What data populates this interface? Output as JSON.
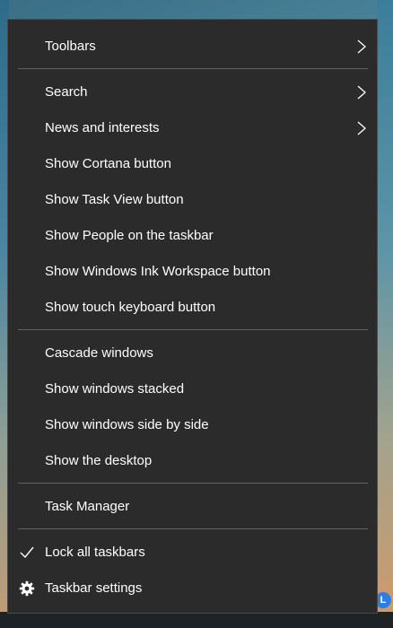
{
  "menu": {
    "toolbars": "Toolbars",
    "search": "Search",
    "news": "News and interests",
    "cortana": "Show Cortana button",
    "taskview": "Show Task View button",
    "people": "Show People on the taskbar",
    "ink": "Show Windows Ink Workspace button",
    "touch_keyboard": "Show touch keyboard button",
    "cascade": "Cascade windows",
    "stacked": "Show windows stacked",
    "side_by_side": "Show windows side by side",
    "desktop": "Show the desktop",
    "task_manager": "Task Manager",
    "lock": "Lock all taskbars",
    "settings": "Taskbar settings"
  },
  "icons": {
    "submenu": "chevron-right-icon",
    "lock_state": "checkmark-icon",
    "settings": "gear-icon"
  },
  "colors": {
    "menu_bg": "#2b2b2b",
    "text": "#ffffff",
    "separator": "#626262"
  }
}
